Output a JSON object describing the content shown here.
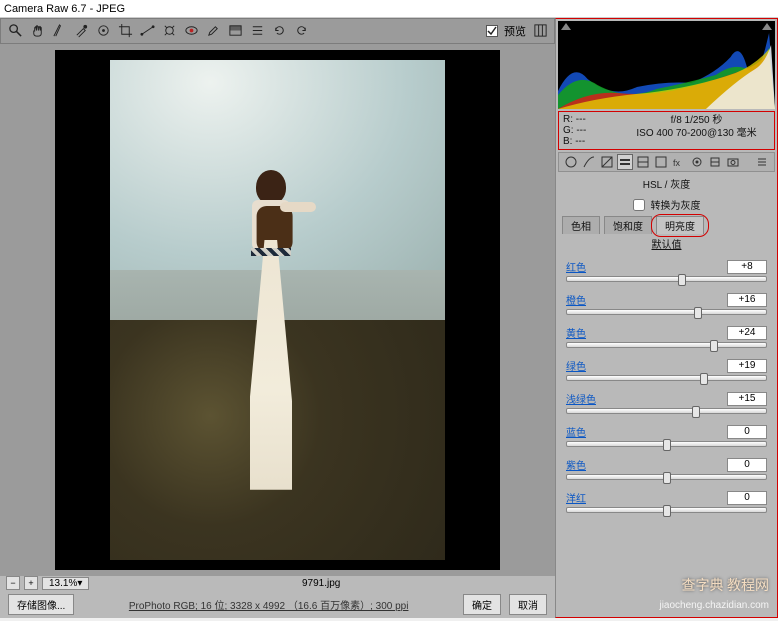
{
  "window": {
    "title": "Camera Raw 6.7  -  JPEG"
  },
  "preview": {
    "checkbox_label": "预览"
  },
  "status": {
    "zoom": "13.1%",
    "filename": "9791.jpg"
  },
  "footer": {
    "save_button": "存储图像...",
    "desc": "ProPhoto RGB; 16 位; 3328 x 4992 （16.6 百万像素）; 300 ppi",
    "done": "确定",
    "cancel": "取消"
  },
  "exif": {
    "r": "R:  ---",
    "g": "G:  ---",
    "b": "B:  ---",
    "line1": "f/8  1/250 秒",
    "line2": "ISO 400  70-200@130 毫米"
  },
  "panel": {
    "title": "HSL / 灰度",
    "gray_label": "转换为灰度",
    "tabs": {
      "hue": "色相",
      "sat": "饱和度",
      "lum": "明亮度"
    },
    "defaults": "默认值"
  },
  "sliders": [
    {
      "label": "红色",
      "value": "+8"
    },
    {
      "label": "橙色",
      "value": "+16"
    },
    {
      "label": "黄色",
      "value": "+24"
    },
    {
      "label": "绿色",
      "value": "+19"
    },
    {
      "label": "浅绿色",
      "value": "+15"
    },
    {
      "label": "蓝色",
      "value": "0"
    },
    {
      "label": "紫色",
      "value": "0"
    },
    {
      "label": "洋红",
      "value": "0"
    }
  ],
  "watermark": {
    "brand": "查字典  教程网",
    "url": "jiaocheng.chazidian.com"
  }
}
